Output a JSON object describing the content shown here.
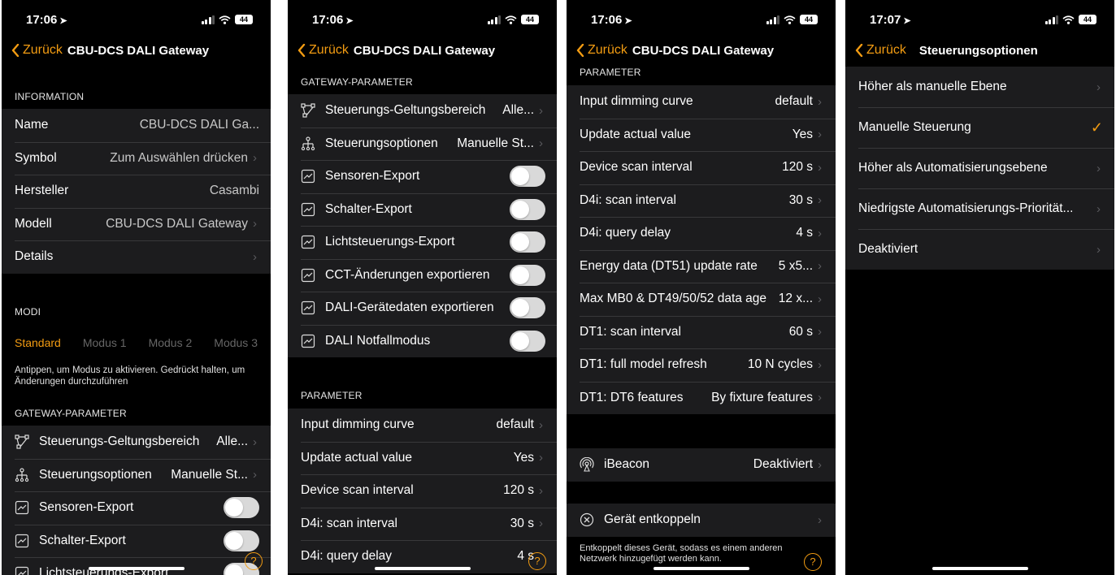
{
  "colors": {
    "accent": "#f39c12",
    "background": "#000000",
    "cell": "#1c1c1e"
  },
  "status": {
    "time1": "17:06",
    "time2": "17:06",
    "time3": "17:06",
    "time4": "17:07",
    "battery": "44"
  },
  "common": {
    "back": "Zurück",
    "device_title": "CBU-DCS DALI Gateway",
    "help": "?"
  },
  "screen1": {
    "info_header": "INFORMATION",
    "info": [
      {
        "label": "Name",
        "value": "CBU-DCS DALI Ga...",
        "chevron": false
      },
      {
        "label": "Symbol",
        "value": "Zum Auswählen drücken",
        "chevron": true
      },
      {
        "label": "Hersteller",
        "value": "Casambi",
        "chevron": false
      },
      {
        "label": "Modell",
        "value": "CBU-DCS DALI Gateway",
        "chevron": true
      },
      {
        "label": "Details",
        "value": "",
        "chevron": true
      }
    ],
    "modi_header": "MODI",
    "modes": [
      "Standard",
      "Modus 1",
      "Modus 2",
      "Modus 3"
    ],
    "modes_hint": "Antippen, um Modus zu aktivieren. Gedrückt halten, um Änderungen durchzuführen",
    "gateway_header": "GATEWAY-PARAMETER",
    "gateway": [
      {
        "label": "Steuerungs-Geltungsbereich",
        "value": "Alle..."
      },
      {
        "label": "Steuerungsoptionen",
        "value": "Manuelle St..."
      },
      {
        "label": "Sensoren-Export"
      },
      {
        "label": "Schalter-Export"
      },
      {
        "label": "Lichtsteuerungs-Export"
      }
    ]
  },
  "screen2": {
    "gateway_header": "GATEWAY-PARAMETER",
    "gateway": [
      {
        "label": "Steuerungs-Geltungsbereich",
        "value": "Alle..."
      },
      {
        "label": "Steuerungsoptionen",
        "value": "Manuelle St..."
      },
      {
        "label": "Sensoren-Export",
        "on": false
      },
      {
        "label": "Schalter-Export",
        "on": false
      },
      {
        "label": "Lichtsteuerungs-Export",
        "on": false
      },
      {
        "label": "CCT-Änderungen exportieren",
        "on": false
      },
      {
        "label": "DALI-Gerätedaten exportieren",
        "on": false
      },
      {
        "label": "DALI Notfallmodus",
        "on": false
      }
    ],
    "param_header": "PARAMETER",
    "params": [
      {
        "label": "Input dimming curve",
        "value": "default"
      },
      {
        "label": "Update actual value",
        "value": "Yes"
      },
      {
        "label": "Device scan interval",
        "value": "120 s"
      },
      {
        "label": "D4i: scan interval",
        "value": "30 s"
      },
      {
        "label": "D4i: query delay",
        "value": "4 s"
      }
    ]
  },
  "screen3": {
    "param_header": "PARAMETER",
    "params": [
      {
        "label": "Input dimming curve",
        "value": "default"
      },
      {
        "label": "Update actual value",
        "value": "Yes"
      },
      {
        "label": "Device scan interval",
        "value": "120 s"
      },
      {
        "label": "D4i: scan interval",
        "value": "30 s"
      },
      {
        "label": "D4i: query delay",
        "value": "4 s"
      },
      {
        "label": "Energy data (DT51) update rate",
        "value": "5 x5..."
      },
      {
        "label": "Max MB0 & DT49/50/52 data age",
        "value": "12 x..."
      },
      {
        "label": "DT1: scan interval",
        "value": "60 s"
      },
      {
        "label": "DT1: full model refresh",
        "value": "10 N cycles"
      },
      {
        "label": "DT1: DT6 features",
        "value": "By fixture features"
      }
    ],
    "ibeacon": {
      "label": "iBeacon",
      "value": "Deaktiviert"
    },
    "unpair": {
      "label": "Gerät entkoppeln"
    },
    "unpair_hint": "Entkoppelt dieses Gerät, sodass es einem anderen Netzwerk hinzugefügt werden kann."
  },
  "screen4": {
    "title": "Steuerungsoptionen",
    "options": [
      {
        "label": "Höher als manuelle Ebene",
        "selected": false
      },
      {
        "label": "Manuelle Steuerung",
        "selected": true
      },
      {
        "label": "Höher als Automatisierungsebene",
        "selected": false
      },
      {
        "label": "Niedrigste Automatisierungs-Priorität...",
        "selected": false
      },
      {
        "label": "Deaktiviert",
        "selected": false
      }
    ]
  }
}
